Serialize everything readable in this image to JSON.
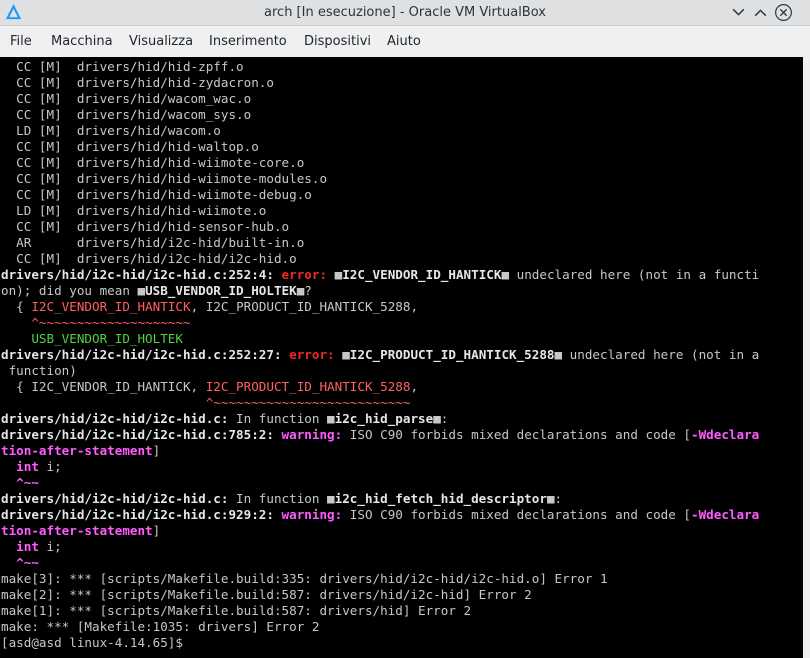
{
  "window": {
    "title": "arch [In esecuzione] - Oracle VM VirtualBox",
    "icons": {
      "app": "virtualbox-icon",
      "minimize": "chevron-down-icon",
      "restore": "chevron-up-icon",
      "close": "close-icon"
    }
  },
  "menu": {
    "file": "File",
    "machine": "Macchina",
    "view": "Visualizza",
    "input": "Inserimento",
    "devices": "Dispositivi",
    "help": "Aiuto"
  },
  "terminal": {
    "lines": [
      "  CC [M]  drivers/hid/hid-zpff.o",
      "  CC [M]  drivers/hid/hid-zydacron.o",
      "  CC [M]  drivers/hid/wacom_wac.o",
      "  CC [M]  drivers/hid/wacom_sys.o",
      "  LD [M]  drivers/hid/wacom.o",
      "  CC [M]  drivers/hid/hid-waltop.o",
      "  CC [M]  drivers/hid/hid-wiimote-core.o",
      "  CC [M]  drivers/hid/hid-wiimote-modules.o",
      "  CC [M]  drivers/hid/hid-wiimote-debug.o",
      "  LD [M]  drivers/hid/hid-wiimote.o",
      "  CC [M]  drivers/hid/hid-sensor-hub.o",
      "  AR      drivers/hid/i2c-hid/built-in.o",
      "  CC [M]  drivers/hid/i2c-hid/i2c-hid.o"
    ],
    "e1": {
      "loc": "drivers/hid/i2c-hid/i2c-hid.c:252:4: ",
      "label": "error:",
      "q1": " ■",
      "sym": "I2C_VENDOR_ID_HANTICK",
      "q2": "■ undeclared here (not in a functi",
      "l2": "on); did you mean ■",
      "sug": "USB_VENDOR_ID_HOLTEK",
      "l2b": "■?",
      "code_pre": "  { ",
      "code_sym": "I2C_VENDOR_ID_HANTICK",
      "code_post": ", I2C_PRODUCT_ID_HANTICK_5288,",
      "tilde": "    ^~~~~~~~~~~~~~~~~~~~~",
      "fix": "    USB_VENDOR_ID_HOLTEK"
    },
    "e2": {
      "loc": "drivers/hid/i2c-hid/i2c-hid.c:252:27: ",
      "label": "error:",
      "q1": " ■",
      "sym": "I2C_PRODUCT_ID_HANTICK_5288",
      "q2": "■ undeclared here (not in a",
      "l2": " function)",
      "code_pre": "  { I2C_VENDOR_ID_HANTICK, ",
      "code_sym": "I2C_PRODUCT_ID_HANTICK_5288",
      "code_post": ",",
      "tilde": "                           ^~~~~~~~~~~~~~~~~~~~~~~~~~~"
    },
    "w1": {
      "fn_pre": "drivers/hid/i2c-hid/i2c-hid.c:",
      "fn_mid": " In function ■",
      "fn_name": "i2c_hid_parse",
      "fn_post": "■:",
      "loc": "drivers/hid/i2c-hid/i2c-hid.c:785:2: ",
      "label": "warning:",
      "msg": " ISO C90 forbids mixed declarations and code [",
      "flag": "-Wdeclara",
      "flag2": "tion-after-statement",
      "end": "]",
      "code_kw": "int",
      "code_rest": " i;",
      "caret": "  ^~~"
    },
    "w2": {
      "fn_pre": "drivers/hid/i2c-hid/i2c-hid.c:",
      "fn_mid": " In function ■",
      "fn_name": "i2c_hid_fetch_hid_descriptor",
      "fn_post": "■:",
      "loc": "drivers/hid/i2c-hid/i2c-hid.c:929:2: ",
      "label": "warning:",
      "msg": " ISO C90 forbids mixed declarations and code [",
      "flag": "-Wdeclara",
      "flag2": "tion-after-statement",
      "end": "]",
      "code_kw": "int",
      "code_rest": " i;",
      "caret": "  ^~~"
    },
    "make": [
      "make[3]: *** [scripts/Makefile.build:335: drivers/hid/i2c-hid/i2c-hid.o] Error 1",
      "make[2]: *** [scripts/Makefile.build:587: drivers/hid/i2c-hid] Error 2",
      "make[1]: *** [scripts/Makefile.build:587: drivers/hid] Error 2",
      "make: *** [Makefile:1035: drivers] Error 2"
    ],
    "prompt": "[asd@asd linux-4.14.65]$"
  },
  "colors": {
    "error": "#ef2929",
    "warning": "#ff5cff",
    "symbol": "#ff6060",
    "fixit": "#4fd343",
    "text": "#c5c8c6"
  }
}
